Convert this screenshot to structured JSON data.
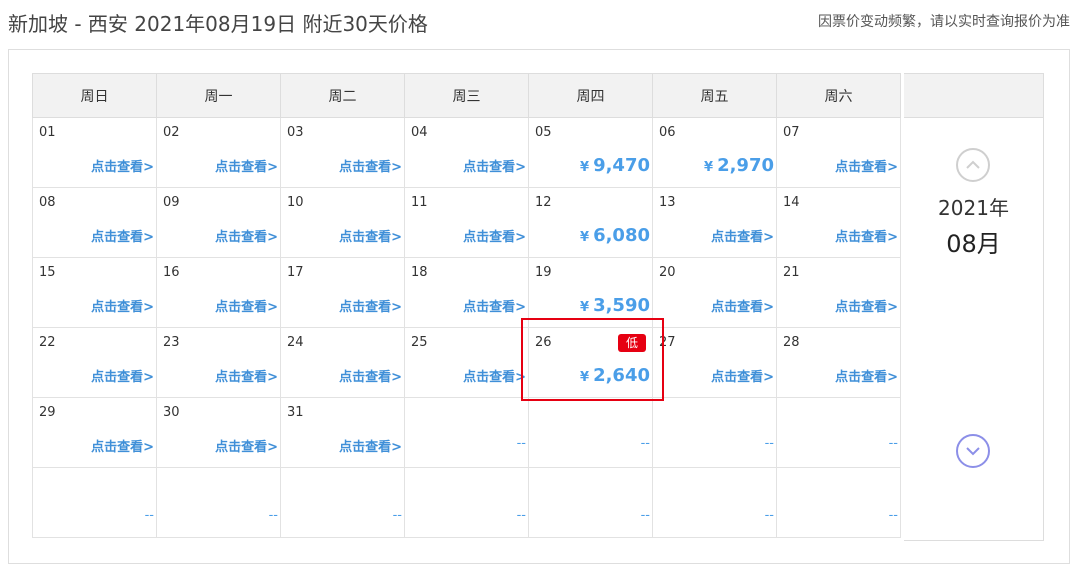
{
  "header": {
    "title": "新加坡 - 西安 2021年08月19日  附近30天价格",
    "notice": "因票价变动频繁，请以实时查询报价为准"
  },
  "calendar": {
    "weekdays": [
      "周日",
      "周一",
      "周二",
      "周三",
      "周四",
      "周五",
      "周六"
    ],
    "view_label": "点击查看>",
    "empty_label": "--",
    "currency_symbol": "¥",
    "low_badge": "低",
    "weeks": [
      [
        {
          "day": "01",
          "type": "link"
        },
        {
          "day": "02",
          "type": "link"
        },
        {
          "day": "03",
          "type": "link"
        },
        {
          "day": "04",
          "type": "link"
        },
        {
          "day": "05",
          "type": "price",
          "price": "9,470"
        },
        {
          "day": "06",
          "type": "price",
          "price": "2,970"
        },
        {
          "day": "07",
          "type": "link"
        }
      ],
      [
        {
          "day": "08",
          "type": "link"
        },
        {
          "day": "09",
          "type": "link"
        },
        {
          "day": "10",
          "type": "link"
        },
        {
          "day": "11",
          "type": "link"
        },
        {
          "day": "12",
          "type": "price",
          "price": "6,080"
        },
        {
          "day": "13",
          "type": "link"
        },
        {
          "day": "14",
          "type": "link"
        }
      ],
      [
        {
          "day": "15",
          "type": "link"
        },
        {
          "day": "16",
          "type": "link"
        },
        {
          "day": "17",
          "type": "link"
        },
        {
          "day": "18",
          "type": "link"
        },
        {
          "day": "19",
          "type": "price",
          "price": "3,590"
        },
        {
          "day": "20",
          "type": "link"
        },
        {
          "day": "21",
          "type": "link"
        }
      ],
      [
        {
          "day": "22",
          "type": "link"
        },
        {
          "day": "23",
          "type": "link"
        },
        {
          "day": "24",
          "type": "link"
        },
        {
          "day": "25",
          "type": "link"
        },
        {
          "day": "26",
          "type": "price",
          "price": "2,640",
          "low": true
        },
        {
          "day": "27",
          "type": "link"
        },
        {
          "day": "28",
          "type": "link"
        }
      ],
      [
        {
          "day": "29",
          "type": "link"
        },
        {
          "day": "30",
          "type": "link"
        },
        {
          "day": "31",
          "type": "link"
        },
        {
          "day": "",
          "type": "empty"
        },
        {
          "day": "",
          "type": "empty"
        },
        {
          "day": "",
          "type": "empty"
        },
        {
          "day": "",
          "type": "empty"
        }
      ],
      [
        {
          "day": "",
          "type": "empty"
        },
        {
          "day": "",
          "type": "empty"
        },
        {
          "day": "",
          "type": "empty"
        },
        {
          "day": "",
          "type": "empty"
        },
        {
          "day": "",
          "type": "empty"
        },
        {
          "day": "",
          "type": "empty"
        },
        {
          "day": "",
          "type": "empty"
        }
      ]
    ]
  },
  "month_nav": {
    "year": "2021年",
    "month": "08月",
    "up_icon": "chevron-up-icon",
    "down_icon": "chevron-down-icon"
  },
  "colors": {
    "price": "#4a9ee8",
    "link": "#3f8fd8",
    "low_badge": "#e60012",
    "highlight": "#e60012"
  }
}
